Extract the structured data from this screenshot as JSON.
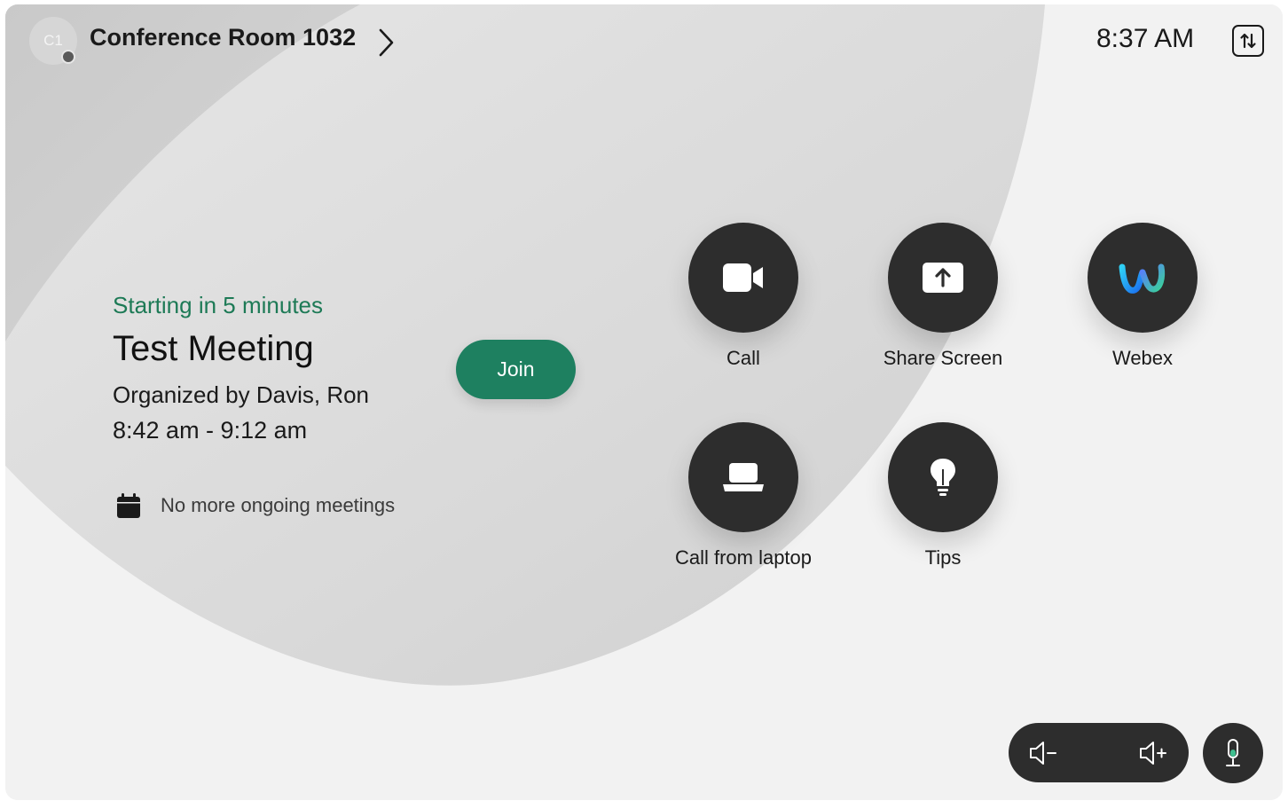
{
  "header": {
    "avatar_initials": "C1",
    "room_name": "Conference Room 1032",
    "time": "8:37 AM"
  },
  "meeting": {
    "status": "Starting in 5 minutes",
    "title": "Test Meeting",
    "organizer": "Organized by Davis, Ron",
    "time_range": "8:42 am - 9:12 am",
    "join_label": "Join",
    "no_more_meetings": "No more ongoing meetings"
  },
  "actions": [
    {
      "label": "Call",
      "icon": "video-camera-icon"
    },
    {
      "label": "Share Screen",
      "icon": "share-screen-icon"
    },
    {
      "label": "Webex",
      "icon": "webex-logo-icon"
    },
    {
      "label": "Call from laptop",
      "icon": "laptop-icon"
    },
    {
      "label": "Tips",
      "icon": "lightbulb-icon"
    }
  ],
  "controls": {
    "volume_down_icon": "volume-down-icon",
    "volume_up_icon": "volume-up-icon",
    "mic_icon": "microphone-icon"
  },
  "colors": {
    "accent_green": "#1e8060",
    "status_green": "#1d7a56",
    "button_dark": "#2d2d2d",
    "background": "#efefef",
    "mic_accent": "#3fbf8f"
  }
}
